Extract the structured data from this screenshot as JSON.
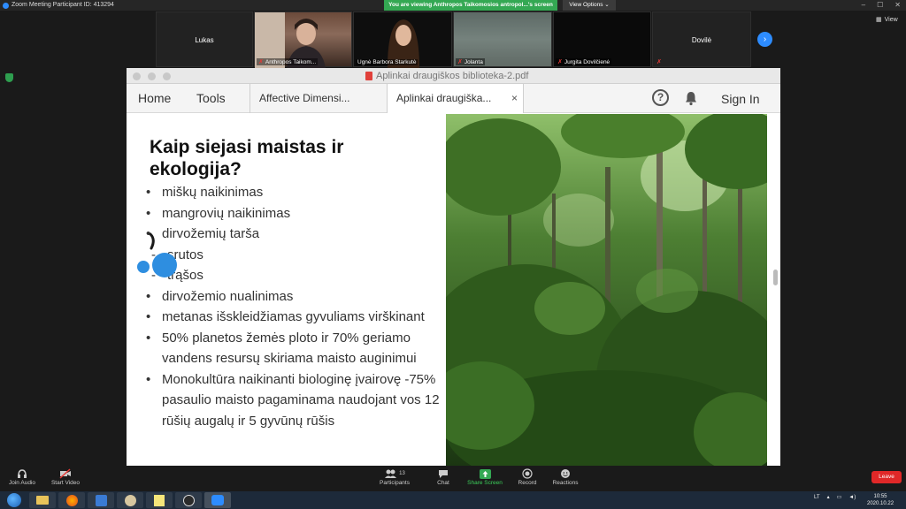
{
  "zoom": {
    "window_title": "Zoom Meeting Participant ID: 413294",
    "viewing_banner": "You are viewing Anthropos Taikomosios antropol...'s screen",
    "view_options": "View Options",
    "view_button": "View"
  },
  "participants": [
    {
      "name": "Lukas"
    },
    {
      "caption": "Anthropos Taikom..."
    },
    {
      "caption": "Ugnė Barbora Starkutė"
    },
    {
      "caption": "Jolanta"
    },
    {
      "caption": "Jurgita Dovilčienė"
    },
    {
      "name": "Dovilė"
    }
  ],
  "pdf": {
    "title": "Aplinkai draugiškos biblioteka-2.pdf",
    "nav": {
      "home": "Home",
      "tools": "Tools"
    },
    "tabs": [
      {
        "label": "Affective Dimensi..."
      },
      {
        "label": "Aplinkai draugiška..."
      }
    ],
    "tab_close": "×",
    "help": "?",
    "sign_in": "Sign In"
  },
  "slide": {
    "title": "Kaip siejasi maistas ir ekologija?",
    "bullets": [
      {
        "marker": "•",
        "text": "miškų naikinimas"
      },
      {
        "marker": "•",
        "text": "mangrovių naikinimas"
      },
      {
        "marker": "•",
        "text": "dirvožemių tarša"
      },
      {
        "marker": "-",
        "text": "srutos"
      },
      {
        "marker": "-",
        "text": "trąšos"
      },
      {
        "marker": "•",
        "text": "dirvožemio nualinimas"
      },
      {
        "marker": "•",
        "text": "metanas išskleidžiamas gyvuliams virškinant"
      },
      {
        "marker": "•",
        "text": "50% planetos žemės ploto ir 70% geriamo vandens resursų skiriama maisto auginimui"
      },
      {
        "marker": "•",
        "text": "Monokultūra naikinanti biologinę įvairovę -75% pasaulio maisto pagaminama naudojant vos  12 rūšių augalų ir  5 gyvūnų rūšis"
      }
    ]
  },
  "controls": {
    "join_audio": "Join Audio",
    "start_video": "Start Video",
    "participants": "Participants",
    "participants_count": "13",
    "chat": "Chat",
    "share_screen": "Share Screen",
    "record": "Record",
    "reactions": "Reactions",
    "leave": "Leave"
  },
  "taskbar": {
    "language": "LT",
    "time": "10:55",
    "date": "2020.10.22"
  },
  "colors": {
    "zoom_blue": "#2d8cff",
    "share_green": "#34a853",
    "leave_red": "#e02828",
    "annotation_blue": "#2e8ee0"
  }
}
